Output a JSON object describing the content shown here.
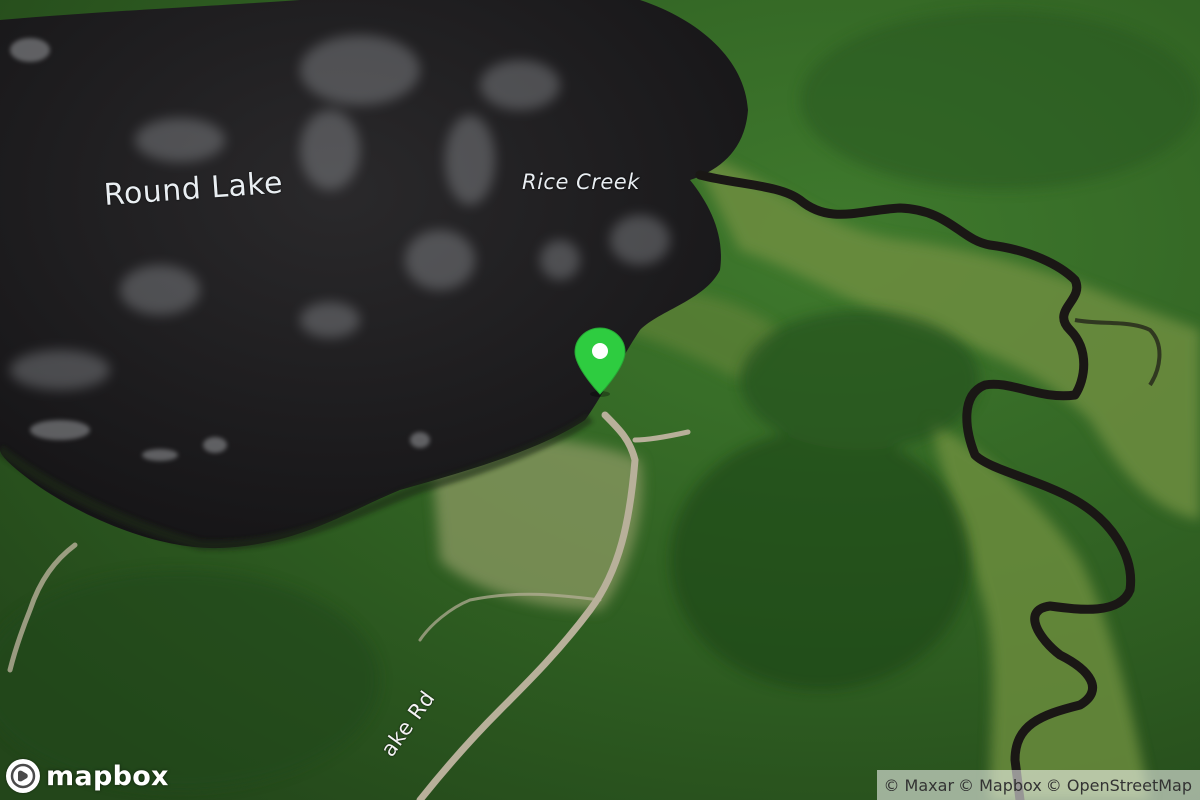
{
  "map": {
    "view": "satellite",
    "labels": {
      "lake": "Round Lake",
      "creek": "Rice Creek",
      "road": "ake Rd"
    },
    "marker": {
      "color": "#2ecc40",
      "icon": "map-pin-icon"
    }
  },
  "branding": {
    "logo_text": "mapbox",
    "logo_icon": "mapbox-logo-icon"
  },
  "attribution": {
    "items": [
      "© Maxar",
      "© Mapbox",
      "© OpenStreetMap"
    ]
  },
  "colors": {
    "water": "#1d1c1d",
    "forest": "#2f5a24",
    "marsh": "#6a8a3c",
    "road": "#b8b09a",
    "marker": "#2ecc40"
  }
}
